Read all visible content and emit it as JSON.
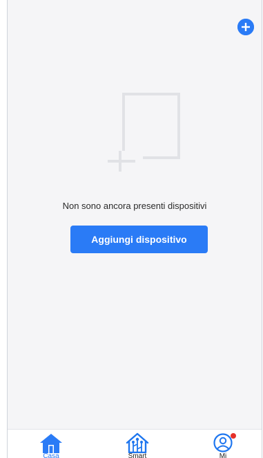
{
  "screen": {
    "empty_message": "Non sono ancora presenti dispositivi",
    "add_device_label": "Aggiungi dispositivo"
  },
  "top_bar": {
    "add_icon": "plus-circle-icon"
  },
  "tabbar": {
    "items": [
      {
        "label": "Casa",
        "icon": "home-icon",
        "active": true
      },
      {
        "label": "Smart",
        "icon": "smart-home-icon",
        "active": false
      },
      {
        "label": "Mi",
        "icon": "profile-icon",
        "active": false,
        "badge": true
      }
    ]
  },
  "colors": {
    "accent": "#2a7bf6",
    "background": "#f5f5f7",
    "badge": "#e5312a",
    "illustration": "#e1e2e6"
  }
}
